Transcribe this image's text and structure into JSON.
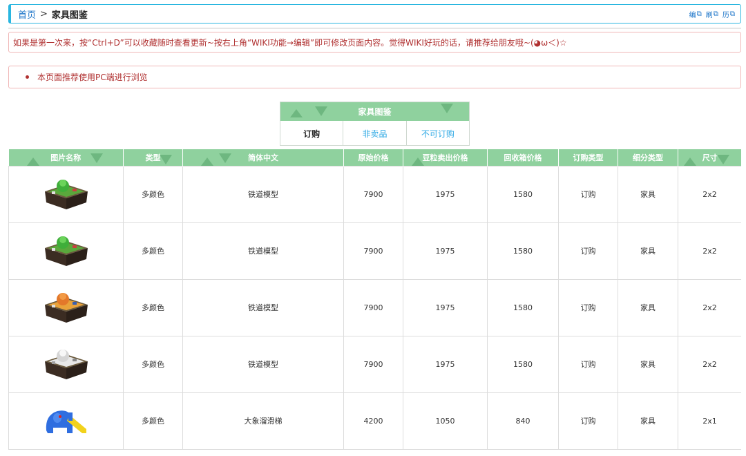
{
  "breadcrumb": {
    "home": "首页",
    "separator": ">",
    "current": "家具图鉴"
  },
  "toolbar": {
    "edit": "编",
    "refresh": "刷",
    "history": "历",
    "ext_glyph": "⧉"
  },
  "notice": {
    "text": "如果是第一次来，按“Ctrl+D”可以收藏随时查看更新~按右上角“WIKI功能→编辑”即可修改页面内容。觉得WIKI好玩的话，请推荐给朋友哦~(◕ω＜)☆"
  },
  "pc_notice": {
    "text": "本页面推荐使用PC端进行浏览"
  },
  "tabs": {
    "title": "家具图鉴",
    "items": [
      {
        "label": "订购"
      },
      {
        "label": "非卖品"
      },
      {
        "label": "不可订购"
      }
    ]
  },
  "table": {
    "headers": [
      "图片名称",
      "类型",
      "简体中文",
      "原始价格",
      "豆粒卖出价格",
      "回收箱价格",
      "订购类型",
      "细分类型",
      "尺寸"
    ],
    "rows": [
      {
        "icon": "train-model-green-icon",
        "type": "多颜色",
        "name_cn": "铁道模型",
        "orig_price": "7900",
        "sell_price": "1975",
        "recycle_price": "1580",
        "order_type": "订购",
        "sub_type": "家具",
        "size": "2x2"
      },
      {
        "icon": "train-model-green-icon",
        "type": "多颜色",
        "name_cn": "铁道模型",
        "orig_price": "7900",
        "sell_price": "1975",
        "recycle_price": "1580",
        "order_type": "订购",
        "sub_type": "家具",
        "size": "2x2"
      },
      {
        "icon": "train-model-orange-icon",
        "type": "多颜色",
        "name_cn": "铁道模型",
        "orig_price": "7900",
        "sell_price": "1975",
        "recycle_price": "1580",
        "order_type": "订购",
        "sub_type": "家具",
        "size": "2x2"
      },
      {
        "icon": "train-model-white-icon",
        "type": "多颜色",
        "name_cn": "铁道模型",
        "orig_price": "7900",
        "sell_price": "1975",
        "recycle_price": "1580",
        "order_type": "订购",
        "sub_type": "家具",
        "size": "2x2"
      },
      {
        "icon": "elephant-slide-icon",
        "type": "多颜色",
        "name_cn": "大象溜滑梯",
        "orig_price": "4200",
        "sell_price": "1050",
        "recycle_price": "840",
        "order_type": "订购",
        "sub_type": "家具",
        "size": "2x1"
      }
    ]
  },
  "colors": {
    "accent_blue": "#29b6e0",
    "header_green": "#8fd19e",
    "notice_red": "#b03030",
    "link_blue": "#2aa7e4"
  }
}
